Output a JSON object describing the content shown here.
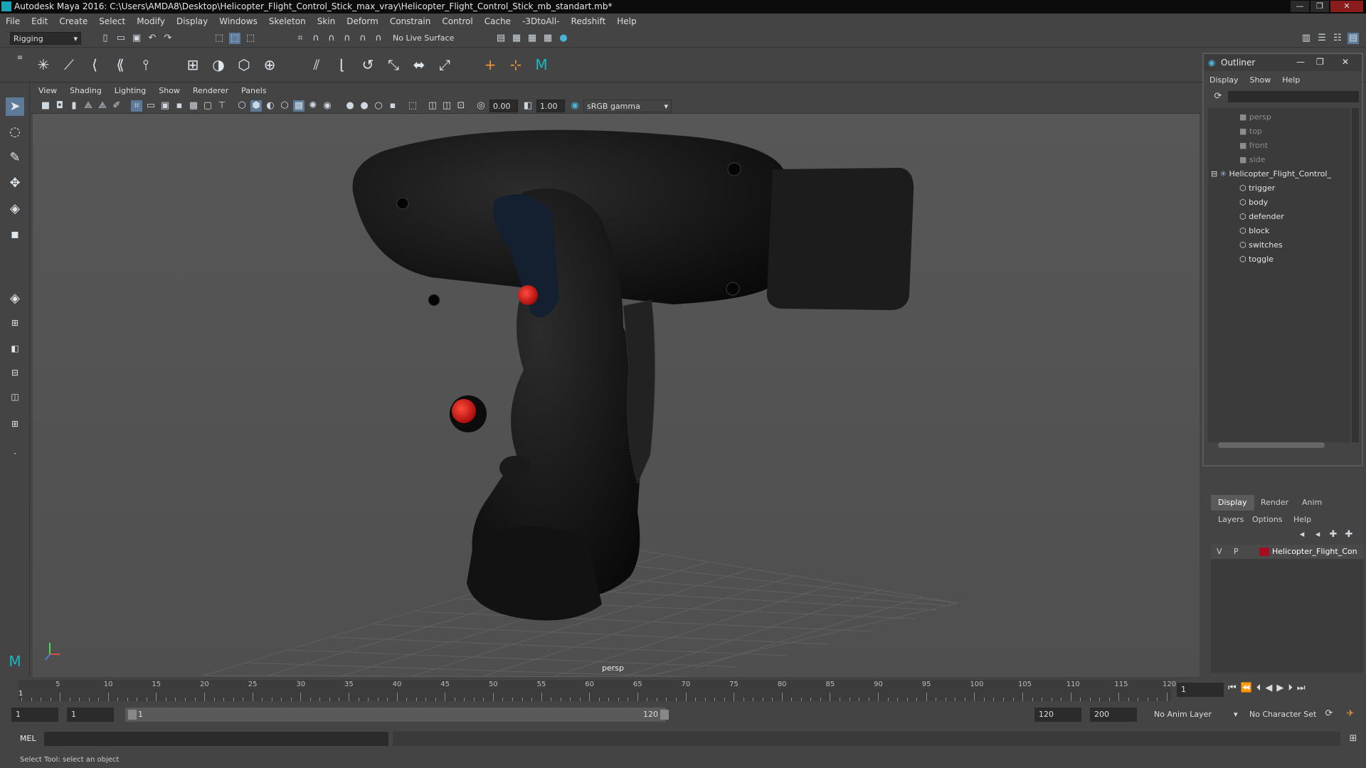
{
  "title": "Autodesk Maya 2016: C:\\Users\\AMDA8\\Desktop\\Helicopter_Flight_Control_Stick_max_vray\\Helicopter_Flight_Control_Stick_mb_standart.mb*",
  "menu": [
    "File",
    "Edit",
    "Create",
    "Select",
    "Modify",
    "Display",
    "Windows",
    "Skeleton",
    "Skin",
    "Deform",
    "Constrain",
    "Control",
    "Cache",
    "-3DtoAll-",
    "Redshift",
    "Help"
  ],
  "mode_dropdown": "Rigging",
  "live_surface": "No Live Surface",
  "viewport_menu": [
    "View",
    "Shading",
    "Lighting",
    "Show",
    "Renderer",
    "Panels"
  ],
  "viewport_fields": {
    "value_a": "0.00",
    "value_b": "1.00",
    "color_space": "sRGB gamma"
  },
  "camera_label": "persp",
  "outliner": {
    "title": "Outliner",
    "menu": [
      "Display",
      "Show",
      "Help"
    ],
    "cameras": [
      "persp",
      "top",
      "front",
      "side"
    ],
    "root": "Helicopter_Flight_Control_",
    "children": [
      "trigger",
      "body",
      "defender",
      "block",
      "switches",
      "toggle"
    ]
  },
  "layers": {
    "tabs": [
      "Display",
      "Render",
      "Anim"
    ],
    "menu": [
      "Layers",
      "Options",
      "Help"
    ],
    "row": {
      "v": "V",
      "p": "P",
      "name": "Helicopter_Flight_Con",
      "color": "#a01020"
    }
  },
  "timeline": {
    "ticks": [
      "5",
      "10",
      "15",
      "20",
      "25",
      "30",
      "35",
      "40",
      "45",
      "50",
      "55",
      "60",
      "65",
      "70",
      "75",
      "80",
      "85",
      "90",
      "95",
      "100",
      "105",
      "110",
      "115",
      "120"
    ],
    "start_label": "1",
    "current_frame": "1"
  },
  "range": {
    "start": "1",
    "playback_start": "1",
    "slider_start": "1",
    "slider_end": "120",
    "playback_end": "120",
    "end": "200",
    "anim_layer": "No Anim Layer",
    "character_set": "No Character Set"
  },
  "cmd": {
    "lang": "MEL"
  },
  "help_line": "Select Tool: select an object"
}
